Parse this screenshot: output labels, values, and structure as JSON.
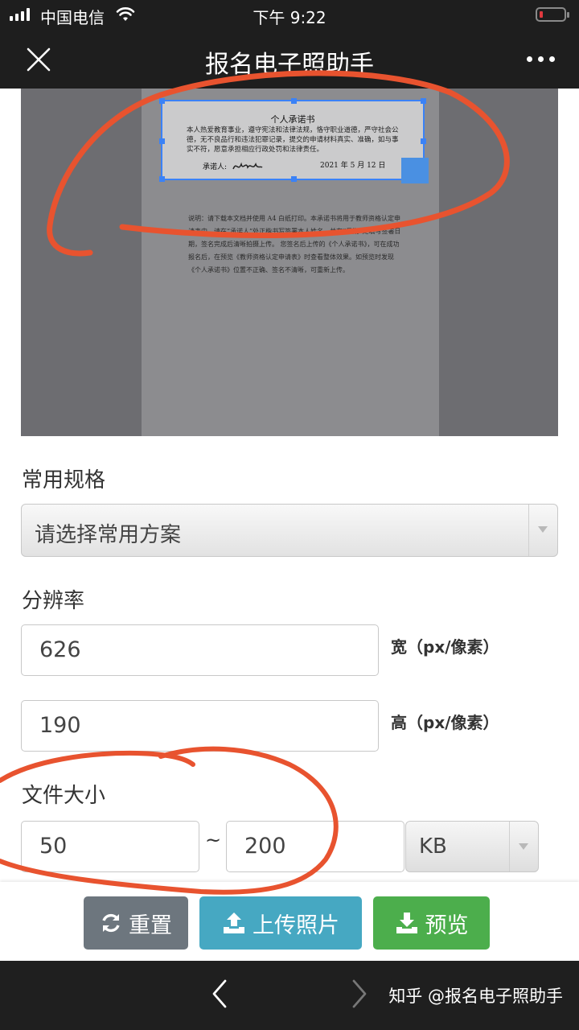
{
  "status_bar": {
    "carrier": "中国电信",
    "time": "下午 9:22",
    "icons": [
      "signal-icon",
      "wifi-icon",
      "battery-icon"
    ]
  },
  "nav": {
    "title": "报名电子照助手",
    "close_icon": "close-icon",
    "more_icon": "more-icon"
  },
  "document_preview": {
    "title": "个人承诺书",
    "body": "本人热爱教育事业，遵守宪法和法律法规，恪守职业道德，严守社会公德，无不良品行和违法犯罪记录，提交的申请材料真实、准确，如与事实不符，愿意承担相应行政处罚和法律责任。",
    "signature_label": "承诺人:",
    "date_text": "2021 年  5 月 12 日",
    "note": "说明：请下载本文档并使用 A4 白纸打印。本承诺书将用于教师资格认定申请表中，请在“承诺人”处正楷书写签署本人姓名，并在“日期”处填写签署日期，签名完成后清晰拍摄上传。 您签名后上传的《个人承诺书》，可在成功报名后，在预览《教师资格认定申请表》时查看整体效果。如预览时发现《个人承诺书》位置不正确、签名不清晰，可重新上传。"
  },
  "form": {
    "common_spec_label": "常用规格",
    "common_spec_value": "请选择常用方案",
    "resolution_label": "分辨率",
    "width_value": "626",
    "width_unit": "宽（px/像素）",
    "height_value": "190",
    "height_unit": "高（px/像素）",
    "file_size_label": "文件大小",
    "size_min": "50",
    "size_separator": "~",
    "size_max": "200",
    "size_unit": "KB"
  },
  "actions": {
    "reset_label": "重置",
    "upload_label": "上传照片",
    "preview_label": "预览",
    "colors": {
      "reset": "#6d767e",
      "upload": "#46a8c2",
      "preview": "#4cae4c"
    }
  },
  "bottom_bar": {
    "watermark": "知乎 @报名电子照助手"
  },
  "annotation_color": "#e8532f"
}
